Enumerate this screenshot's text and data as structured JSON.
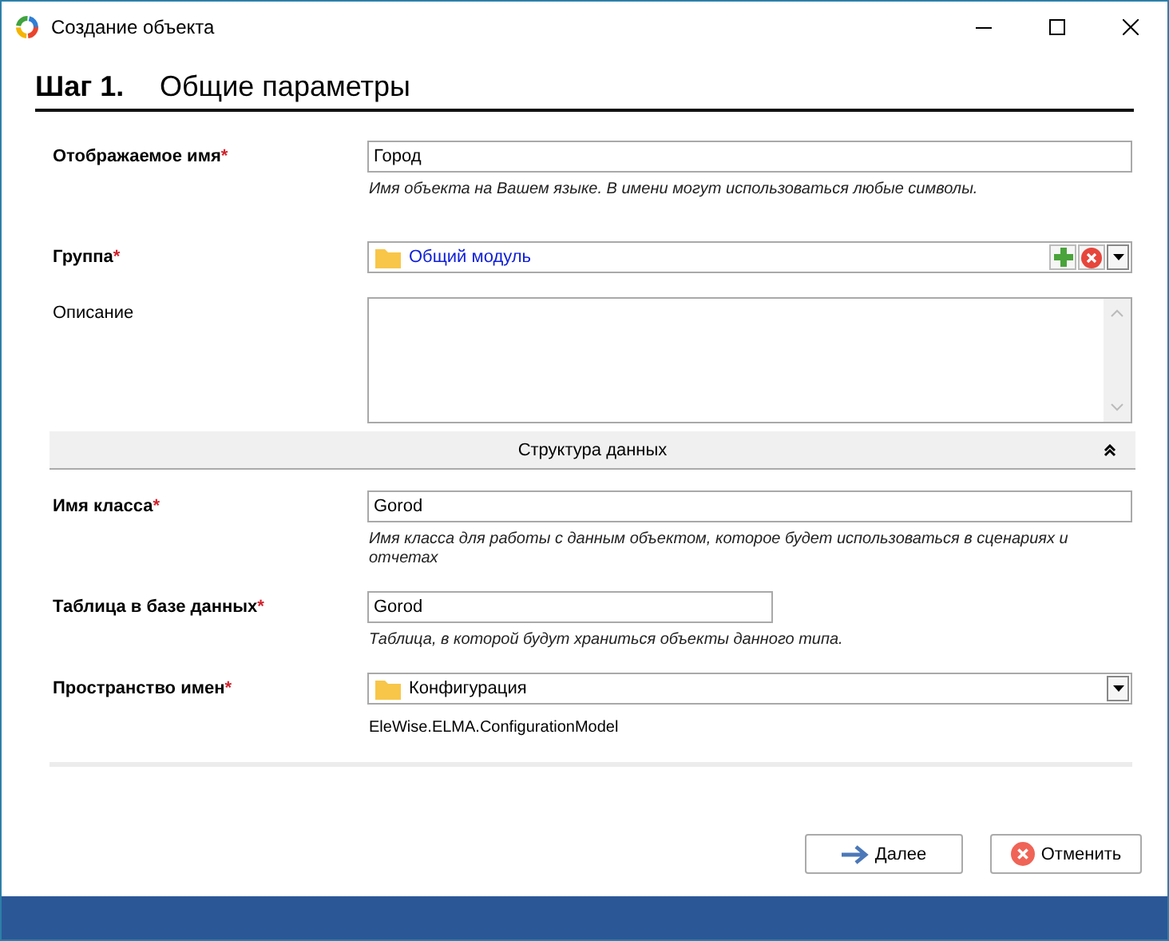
{
  "window": {
    "title": "Создание объекта"
  },
  "step": {
    "number": "Шаг 1.",
    "title": "Общие параметры"
  },
  "required_mark": "*",
  "fields": [
    {
      "kind": "text",
      "label": "Отображаемое имя",
      "required": true,
      "value": "Город",
      "hint": "Имя объекта на Вашем языке. В имени могут использоваться любые символы."
    },
    {
      "kind": "lookup",
      "label": "Группа",
      "required": true,
      "value": "Общий модуль"
    },
    {
      "kind": "textarea",
      "label": "Описание",
      "required": false
    },
    {
      "kind": "section",
      "label": "Структура данных",
      "expanded": true
    },
    {
      "kind": "text",
      "label": "Имя класса",
      "required": true,
      "value": "Gorod",
      "hint": "Имя класса для работы с данным объектом, которое будет использоваться в сценариях и отчетах"
    },
    {
      "kind": "short_text",
      "label": "Таблица в базе данных",
      "required": true,
      "value": "Gorod",
      "hint": "Таблица, в которой будут храниться объекты данного типа."
    },
    {
      "kind": "select",
      "label": "Пространство имен",
      "required": true,
      "value": "Конфигурация",
      "note": "EleWise.ELMA.ConfigurationModel"
    }
  ],
  "buttons": [
    {
      "kind": "next",
      "label": "Далее"
    },
    {
      "kind": "cancel",
      "label": "Отменить"
    }
  ]
}
